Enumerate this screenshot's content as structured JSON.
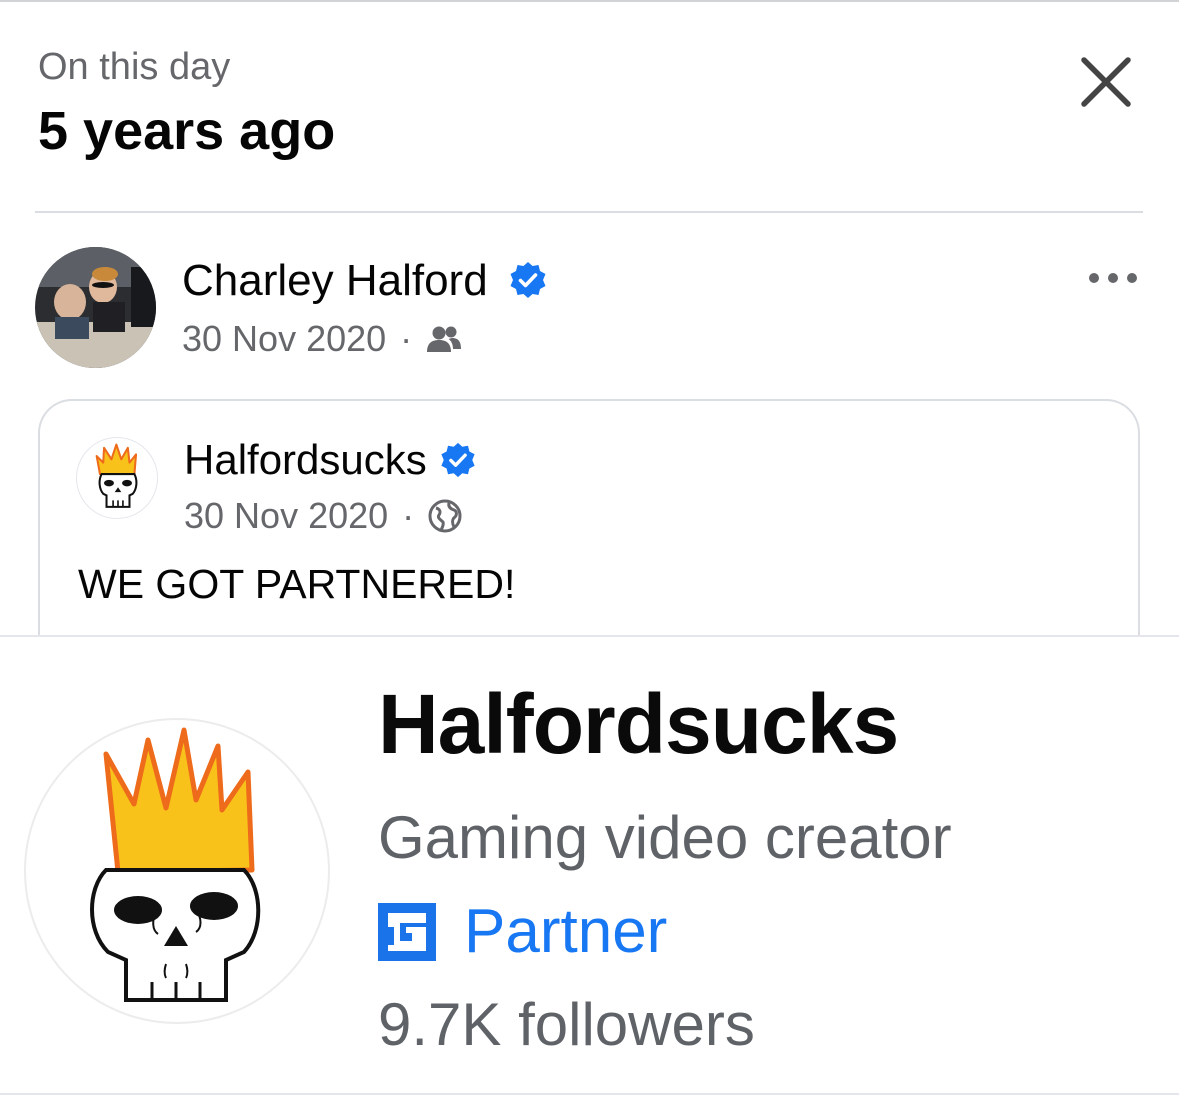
{
  "header": {
    "subtitle": "On this day",
    "title": "5 years ago"
  },
  "post": {
    "author": "Charley Halford",
    "date": "30 Nov 2020",
    "separator": "·",
    "audience_icon": "friends-icon",
    "more_icon": "more-options-icon"
  },
  "shared_post": {
    "page_name": "Halfordsucks",
    "date": "30 Nov 2020",
    "separator": "·",
    "audience_icon": "globe-icon",
    "text": "WE GOT PARTNERED!"
  },
  "image": {
    "profile_name": "Halfordsucks",
    "category": "Gaming video creator",
    "badge_label": "Partner",
    "followers": "9.7K followers"
  },
  "colors": {
    "verified_blue": "#1877f2",
    "secondary_text": "#65676b",
    "flame_yellow": "#f9c21b",
    "flame_orange": "#ee6b1b"
  }
}
